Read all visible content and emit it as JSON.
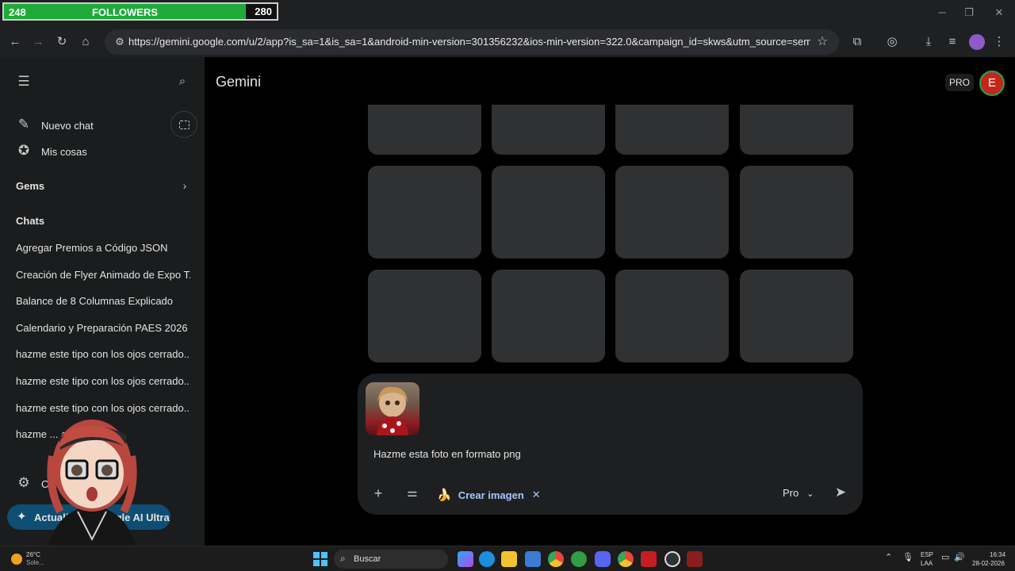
{
  "followers": {
    "current": "248",
    "label": "FOLLOWERS",
    "goal": "280",
    "progress": 0.886
  },
  "browser": {
    "url": "https://gemini.google.com/u/2/app?is_sa=1&is_sa=1&android-min-version=301356232&ios-min-version=322.0&campaign_id=skws&utm_source=sem&utm_sour..."
  },
  "sidebar": {
    "new_chat": "Nuevo chat",
    "my_stuff": "Mis cosas",
    "gems": "Gems",
    "chats_heading": "Chats",
    "chats": [
      "Agregar Premios a Código JSON",
      "Creación de Flyer Animado de Expo T...",
      "Balance de 8 Columnas Explicado",
      "Calendario y Preparación PAES 2026",
      "hazme este tipo con los ojos cerrado...",
      "hazme este tipo con los ojos cerrado...",
      "hazme este tipo con los ojos cerrado...",
      "hazme ... abierta, ..."
    ],
    "settings_partial": "C... ...da",
    "upgrade_label": "Actualizar a Google AI Ultra"
  },
  "header": {
    "title": "Gemini",
    "badge": "PRO",
    "avatar_letter": "E"
  },
  "prompt": {
    "text": "Hazme esta foto en formato png",
    "tool_chip": "Crear imagen",
    "model": "Pro"
  },
  "taskbar": {
    "weather_temp": "26°C",
    "weather_desc": "Sole...",
    "search_label": "Buscar",
    "lang_top": "ESP",
    "lang_bottom": "LAA",
    "time": "16:34",
    "date": "28-02-2026"
  },
  "icons": {
    "back": "arrow-left",
    "forward": "arrow-right",
    "reload": "reload",
    "home": "home",
    "menu": "hamburger",
    "search": "magnifier",
    "send": "paper-plane"
  },
  "colors": {
    "accent_blue": "#a8c7fa",
    "followers_bar": "#1faa3a",
    "avatar_red": "#c4261b",
    "upgrade_button": "#0f4e73"
  }
}
